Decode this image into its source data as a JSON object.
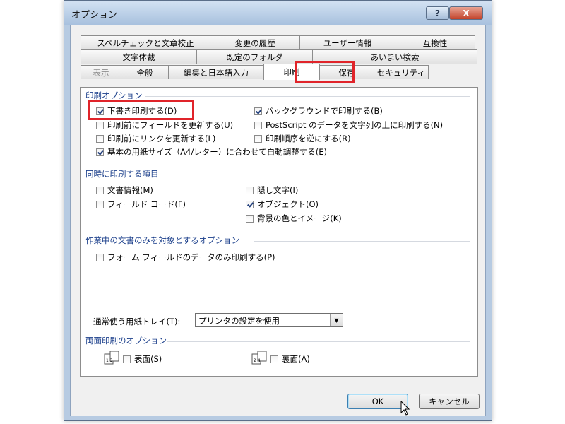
{
  "window": {
    "title": "オプション",
    "help_label": "?",
    "close_label": "X"
  },
  "tabs": {
    "row1": [
      "スペルチェックと文章校正",
      "変更の履歴",
      "ユーザー情報",
      "互換性"
    ],
    "row2": [
      "文字体裁",
      "既定のフォルダ",
      "あいまい検索"
    ],
    "row3": [
      "表示",
      "全般",
      "編集と日本語入力",
      "印刷",
      "保存",
      "セキュリティ"
    ],
    "active": "印刷"
  },
  "print_options": {
    "heading": "印刷オプション",
    "items": [
      {
        "label": "下書き印刷する(D)",
        "checked": true
      },
      {
        "label": "印刷前にフィールドを更新する(U)",
        "checked": false
      },
      {
        "label": "印刷前にリンクを更新する(L)",
        "checked": false
      },
      {
        "label": "基本の用紙サイズ（A4/レター）に合わせて自動調整する(E)",
        "checked": true
      },
      {
        "label": "バックグラウンドで印刷する(B)",
        "checked": true
      },
      {
        "label": "PostScript のデータを文字列の上に印刷する(N)",
        "checked": false
      },
      {
        "label": "印刷順序を逆にする(R)",
        "checked": false
      }
    ]
  },
  "include": {
    "heading": "同時に印刷する項目",
    "items": [
      {
        "label": "文書情報(M)",
        "checked": false
      },
      {
        "label": "フィールド コード(F)",
        "checked": false
      },
      {
        "label": "隠し文字(I)",
        "checked": false
      },
      {
        "label": "オブジェクト(O)",
        "checked": true
      },
      {
        "label": "背景の色とイメージ(K)",
        "checked": false
      }
    ]
  },
  "current_doc": {
    "heading": "作業中の文書のみを対象とするオプション",
    "items": [
      {
        "label": "フォーム フィールドのデータのみ印刷する(P)",
        "checked": false
      }
    ]
  },
  "tray": {
    "label": "通常使う用紙トレイ(T):",
    "value": "プリンタの設定を使用"
  },
  "duplex": {
    "heading": "両面印刷のオプション",
    "front_label": "表面(S)",
    "back_label": "裏面(A)",
    "front_checked": false,
    "back_checked": false,
    "front_icon_text": "1 3",
    "back_icon_text": "2 4"
  },
  "buttons": {
    "ok": "OK",
    "cancel": "キャンセル"
  }
}
